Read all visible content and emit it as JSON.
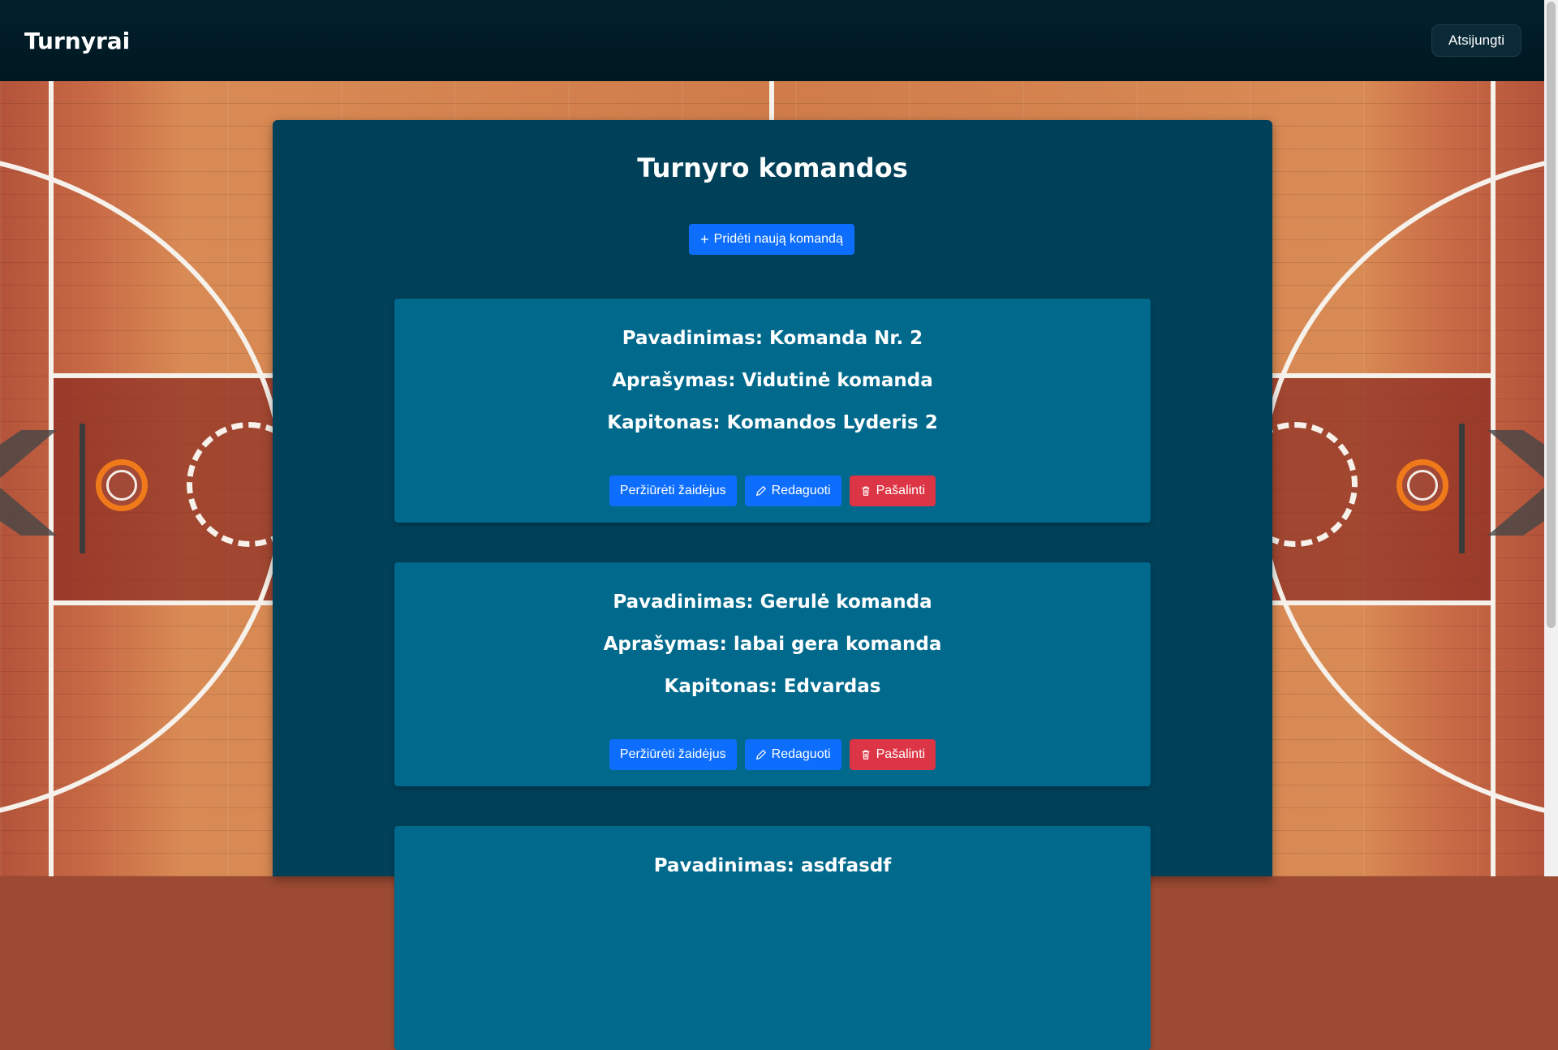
{
  "header": {
    "brand": "Turnyrai",
    "logout_label": "Atsijungti"
  },
  "main": {
    "title": "Turnyro komandos",
    "add_button_label": "Pridėti naują komandą",
    "actions": {
      "view_players_label": "Peržiūrėti žaidėjus",
      "edit_label": "Redaguoti",
      "delete_label": "Pašalinti"
    },
    "teams": [
      {
        "name": "Pavadinimas: Komanda Nr. 2",
        "description": "Aprašymas: Vidutinė komanda",
        "captain": "Kapitonas: Komandos Lyderis 2"
      },
      {
        "name": "Pavadinimas: Gerulė komanda",
        "description": "Aprašymas: labai gera komanda",
        "captain": "Kapitonas: Edvardas"
      },
      {
        "name": "Pavadinimas: asdfasdf",
        "description": "",
        "captain": ""
      }
    ]
  },
  "colors": {
    "topbar": "#001822",
    "panel": "#004058",
    "card": "#00698c",
    "primary": "#0d6efd",
    "danger": "#dc3545",
    "hoop": "#f07a1a"
  }
}
